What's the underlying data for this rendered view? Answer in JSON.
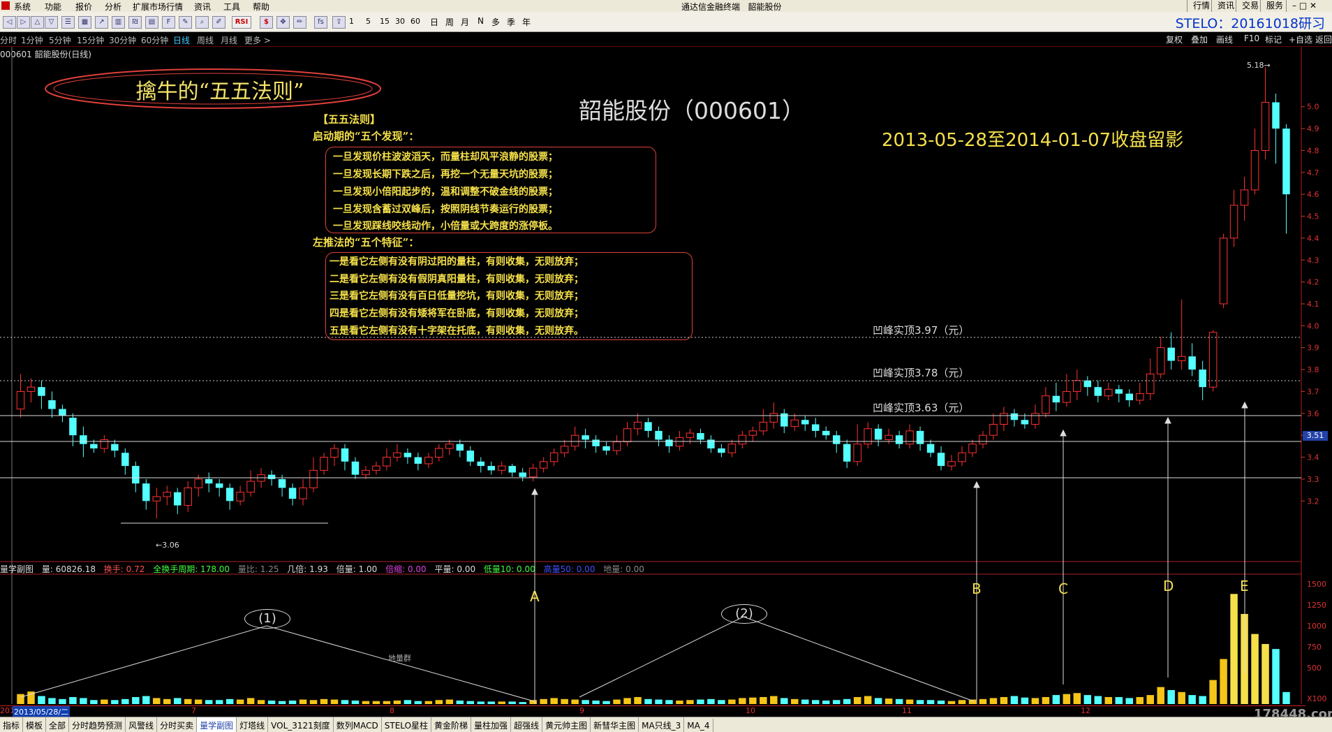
{
  "menubar": {
    "items": [
      "系统",
      "功能",
      "报价",
      "分析",
      "扩展市场行情",
      "资讯",
      "工具",
      "帮助"
    ],
    "window_title": "通达信金融终端",
    "stock_name": "韶能股份",
    "right_items": [
      "行情",
      "资讯",
      "交易",
      "服务"
    ]
  },
  "toolbar": {
    "icons": [
      "back-icon",
      "forward-icon",
      "up-icon",
      "down-icon",
      "list-icon",
      "grid-icon",
      "chart-icon",
      "bar-chart-icon",
      "quote-icon",
      "table-icon",
      "f10-icon",
      "notes-icon",
      "zoom-icon",
      "draw-icon",
      "rsi-icon",
      "money-icon",
      "crosshair-icon",
      "pen-icon",
      "fs-icon",
      "export-icon"
    ],
    "rsi_label": "RSI",
    "numbers": [
      "1",
      "5",
      "15",
      "30",
      "60"
    ],
    "periods": [
      "日",
      "周",
      "月",
      "N",
      "多",
      "季",
      "年"
    ],
    "logo": "STELO：20161018研习"
  },
  "period_bar": {
    "items": [
      "分时",
      "1分钟",
      "5分钟",
      "15分钟",
      "30分钟",
      "60分钟",
      "日线",
      "周线",
      "月线",
      "更多 >"
    ],
    "active": "日线",
    "right_items": [
      "复权",
      "叠加",
      "画线",
      "F10",
      "标记",
      "+自选",
      "返回"
    ]
  },
  "chart_title": "000601 韶能股份(日线)",
  "annotations": {
    "cloud_text": "擒牛的“五五法则”",
    "stock_title": "韶能股份（000601）",
    "date_note": "2013-05-28至2014-01-07收盘留影",
    "rules_title": "【五五法则】",
    "start_heading": "启动期的“五个发现”：",
    "discoveries": [
      "一旦发现价柱波波滔天，而量柱却风平浪静的股票；",
      "一旦发现长期下跌之后，再挖一个无量天坑的股票；",
      "一旦发现小倍阳起步的，温和调整不破金线的股票；",
      "一旦发现含蓄过双峰后，按照阴线节奏运行的股票；",
      "一旦发现踩线咬线动作，小倍量或大跨度的涨停板。"
    ],
    "left_heading": "左推法的“五个特征”：",
    "features": [
      "一是看它左侧有没有阴过阳的量柱，有则收集，无则放弃；",
      "二是看它左侧有没有假阴真阳量柱，有则收集，无则放弃；",
      "三是看它左侧有没有百日低量挖坑，有则收集，无则放弃；",
      "四是看它左侧有没有矮将军在卧底，有则收集，无则放弃；",
      "五是看它左侧有没有十字架在托底，有则收集，无则放弃。"
    ],
    "peaks": [
      "凹峰实顶3.97（元）",
      "凹峰实顶3.78（元）",
      "凹峰实顶3.63（元）"
    ],
    "low_label": "←3.06",
    "high_label": "5.18→",
    "markers": [
      "A",
      "B",
      "C",
      "D",
      "E"
    ],
    "circles": [
      "(1)",
      "(2)"
    ],
    "vol_note": "地量群"
  },
  "price_axis": [
    "5.0",
    "4.9",
    "4.8",
    "4.7",
    "4.6",
    "4.5",
    "4.4",
    "4.3",
    "4.2",
    "4.1",
    "4.0",
    "3.9",
    "3.8",
    "3.7",
    "3.6",
    "3.5",
    "3.4",
    "3.3",
    "3.2"
  ],
  "current_price": "3.51",
  "sub_indicator": {
    "name": "量学副图",
    "vol_label": "量: 60826.18",
    "turnover": "换手: 0.72",
    "total_turnover": "全换手周期: 178.00",
    "vol_ratio": "量比: 1.25",
    "multiple": "几倍: 1.93",
    "double": "倍量: 1.00",
    "shrink": "倍缩: 0.00",
    "flat": "平量: 0.00",
    "low10": "低量10: 0.00",
    "high50": "高量50: 0.00",
    "ground": "地量: 0.00"
  },
  "volume_axis": [
    "1500",
    "1250",
    "1000",
    "750",
    "500",
    "X100"
  ],
  "date_bar": {
    "selected": "2013/05/28/二",
    "months": [
      "7",
      "8",
      "9",
      "10",
      "11",
      "12"
    ],
    "left": "201"
  },
  "bottom_tabs": [
    "指标",
    "模板",
    "全部",
    "分时趋势预测",
    "风警线",
    "分时买卖",
    "量学副图",
    "灯塔线",
    "VOL_3121刻度",
    "数列MACD",
    "STELO星柱",
    "黄金阶梯",
    "量柱加强",
    "超强线",
    "黄元帅主图",
    "新彗华主图",
    "MA只线_3",
    "MA_4"
  ],
  "active_tab": "量学副图",
  "watermark": "178448.com",
  "colors": {
    "up": "#ff3232",
    "down": "#54ffff",
    "accent": "#f5e04a"
  },
  "chart_data": {
    "type": "candlestick",
    "title": "000601 韶能股份(日线)",
    "ylim": [
      3.0,
      5.2
    ],
    "candles": [
      [
        3.62,
        3.7,
        3.78,
        3.58
      ],
      [
        3.7,
        3.72,
        3.76,
        3.65
      ],
      [
        3.72,
        3.68,
        3.75,
        3.62
      ],
      [
        3.66,
        3.62,
        3.7,
        3.58
      ],
      [
        3.62,
        3.59,
        3.64,
        3.56
      ],
      [
        3.58,
        3.5,
        3.6,
        3.45
      ],
      [
        3.5,
        3.46,
        3.54,
        3.4
      ],
      [
        3.46,
        3.44,
        3.48,
        3.42
      ],
      [
        3.44,
        3.48,
        3.5,
        3.42
      ],
      [
        3.46,
        3.43,
        3.48,
        3.4
      ],
      [
        3.42,
        3.36,
        3.44,
        3.32
      ],
      [
        3.36,
        3.28,
        3.38,
        3.24
      ],
      [
        3.28,
        3.2,
        3.3,
        3.16
      ],
      [
        3.2,
        3.22,
        3.26,
        3.12
      ],
      [
        3.22,
        3.24,
        3.27,
        3.18
      ],
      [
        3.24,
        3.18,
        3.26,
        3.14
      ],
      [
        3.18,
        3.26,
        3.29,
        3.15
      ],
      [
        3.26,
        3.3,
        3.32,
        3.22
      ],
      [
        3.3,
        3.28,
        3.33,
        3.24
      ],
      [
        3.28,
        3.26,
        3.3,
        3.22
      ],
      [
        3.26,
        3.2,
        3.28,
        3.16
      ],
      [
        3.2,
        3.24,
        3.27,
        3.18
      ],
      [
        3.24,
        3.29,
        3.34,
        3.22
      ],
      [
        3.29,
        3.32,
        3.35,
        3.26
      ],
      [
        3.32,
        3.3,
        3.34,
        3.27
      ],
      [
        3.3,
        3.26,
        3.32,
        3.22
      ],
      [
        3.26,
        3.21,
        3.28,
        3.18
      ],
      [
        3.21,
        3.26,
        3.3,
        3.18
      ],
      [
        3.26,
        3.34,
        3.4,
        3.24
      ],
      [
        3.34,
        3.4,
        3.42,
        3.32
      ],
      [
        3.4,
        3.44,
        3.46,
        3.36
      ],
      [
        3.44,
        3.38,
        3.46,
        3.34
      ],
      [
        3.38,
        3.32,
        3.4,
        3.3
      ],
      [
        3.32,
        3.34,
        3.36,
        3.3
      ],
      [
        3.34,
        3.36,
        3.38,
        3.32
      ],
      [
        3.36,
        3.4,
        3.44,
        3.34
      ],
      [
        3.4,
        3.42,
        3.46,
        3.38
      ],
      [
        3.42,
        3.4,
        3.44,
        3.37
      ],
      [
        3.4,
        3.37,
        3.42,
        3.34
      ],
      [
        3.37,
        3.4,
        3.42,
        3.35
      ],
      [
        3.4,
        3.44,
        3.46,
        3.38
      ],
      [
        3.44,
        3.46,
        3.48,
        3.41
      ],
      [
        3.46,
        3.43,
        3.48,
        3.4
      ],
      [
        3.43,
        3.38,
        3.45,
        3.36
      ],
      [
        3.38,
        3.36,
        3.4,
        3.33
      ],
      [
        3.36,
        3.34,
        3.38,
        3.32
      ],
      [
        3.34,
        3.36,
        3.38,
        3.32
      ],
      [
        3.36,
        3.33,
        3.37,
        3.31
      ],
      [
        3.33,
        3.31,
        3.35,
        3.29
      ],
      [
        3.31,
        3.35,
        3.37,
        3.29
      ],
      [
        3.35,
        3.38,
        3.4,
        3.33
      ],
      [
        3.38,
        3.42,
        3.44,
        3.36
      ],
      [
        3.42,
        3.45,
        3.48,
        3.4
      ],
      [
        3.45,
        3.5,
        3.54,
        3.43
      ],
      [
        3.5,
        3.48,
        3.53,
        3.44
      ],
      [
        3.48,
        3.45,
        3.5,
        3.42
      ],
      [
        3.45,
        3.43,
        3.47,
        3.41
      ],
      [
        3.43,
        3.47,
        3.5,
        3.41
      ],
      [
        3.47,
        3.53,
        3.56,
        3.45
      ],
      [
        3.53,
        3.56,
        3.6,
        3.5
      ],
      [
        3.56,
        3.52,
        3.58,
        3.49
      ],
      [
        3.52,
        3.48,
        3.54,
        3.45
      ],
      [
        3.48,
        3.45,
        3.5,
        3.42
      ],
      [
        3.45,
        3.49,
        3.52,
        3.43
      ],
      [
        3.49,
        3.51,
        3.53,
        3.46
      ],
      [
        3.51,
        3.48,
        3.53,
        3.46
      ],
      [
        3.48,
        3.44,
        3.5,
        3.42
      ],
      [
        3.44,
        3.42,
        3.46,
        3.4
      ],
      [
        3.42,
        3.46,
        3.48,
        3.4
      ],
      [
        3.46,
        3.5,
        3.52,
        3.44
      ],
      [
        3.5,
        3.52,
        3.54,
        3.47
      ],
      [
        3.52,
        3.56,
        3.62,
        3.5
      ],
      [
        3.56,
        3.6,
        3.65,
        3.53
      ],
      [
        3.6,
        3.54,
        3.62,
        3.51
      ],
      [
        3.54,
        3.57,
        3.6,
        3.52
      ],
      [
        3.57,
        3.55,
        3.59,
        3.52
      ],
      [
        3.55,
        3.52,
        3.58,
        3.49
      ],
      [
        3.52,
        3.5,
        3.54,
        3.48
      ],
      [
        3.5,
        3.46,
        3.52,
        3.42
      ],
      [
        3.46,
        3.38,
        3.48,
        3.35
      ],
      [
        3.38,
        3.46,
        3.55,
        3.36
      ],
      [
        3.46,
        3.53,
        3.56,
        3.44
      ],
      [
        3.53,
        3.48,
        3.55,
        3.45
      ],
      [
        3.48,
        3.5,
        3.53,
        3.46
      ],
      [
        3.5,
        3.46,
        3.52,
        3.44
      ],
      [
        3.46,
        3.52,
        3.55,
        3.44
      ],
      [
        3.52,
        3.46,
        3.54,
        3.43
      ],
      [
        3.46,
        3.42,
        3.48,
        3.4
      ],
      [
        3.42,
        3.36,
        3.45,
        3.34
      ],
      [
        3.36,
        3.38,
        3.41,
        3.34
      ],
      [
        3.38,
        3.42,
        3.45,
        3.36
      ],
      [
        3.42,
        3.46,
        3.48,
        3.4
      ],
      [
        3.46,
        3.5,
        3.52,
        3.44
      ],
      [
        3.5,
        3.55,
        3.6,
        3.48
      ],
      [
        3.55,
        3.6,
        3.63,
        3.52
      ],
      [
        3.6,
        3.57,
        3.62,
        3.54
      ],
      [
        3.57,
        3.55,
        3.6,
        3.53
      ],
      [
        3.55,
        3.6,
        3.64,
        3.53
      ],
      [
        3.6,
        3.68,
        3.72,
        3.58
      ],
      [
        3.68,
        3.65,
        3.74,
        3.61
      ],
      [
        3.65,
        3.7,
        3.78,
        3.63
      ],
      [
        3.7,
        3.75,
        3.8,
        3.66
      ],
      [
        3.75,
        3.72,
        3.77,
        3.68
      ],
      [
        3.72,
        3.68,
        3.75,
        3.65
      ],
      [
        3.68,
        3.71,
        3.74,
        3.66
      ],
      [
        3.71,
        3.69,
        3.73,
        3.65
      ],
      [
        3.69,
        3.66,
        3.71,
        3.63
      ],
      [
        3.66,
        3.69,
        3.74,
        3.64
      ],
      [
        3.69,
        3.78,
        3.85,
        3.66
      ],
      [
        3.78,
        3.9,
        3.95,
        3.76
      ],
      [
        3.9,
        3.84,
        3.97,
        3.8
      ],
      [
        3.84,
        3.86,
        4.12,
        3.8
      ],
      [
        3.86,
        3.8,
        3.92,
        3.77
      ],
      [
        3.8,
        3.72,
        3.84,
        3.66
      ],
      [
        3.72,
        3.97,
        3.98,
        3.7
      ],
      [
        4.1,
        4.4,
        4.42,
        4.08
      ],
      [
        4.4,
        4.55,
        4.62,
        4.36
      ],
      [
        4.55,
        4.62,
        4.68,
        4.48
      ],
      [
        4.62,
        4.8,
        4.9,
        4.6
      ],
      [
        4.8,
        5.02,
        5.18,
        4.76
      ],
      [
        5.02,
        4.9,
        5.06,
        4.74
      ],
      [
        4.9,
        4.6,
        4.92,
        4.42
      ]
    ],
    "volumes": [
      20,
      25,
      16,
      12,
      10,
      14,
      12,
      8,
      9,
      8,
      10,
      14,
      16,
      12,
      10,
      12,
      10,
      9,
      8,
      8,
      10,
      9,
      12,
      8,
      7,
      6,
      7,
      9,
      8,
      10,
      9,
      8,
      7,
      6,
      6,
      6,
      7,
      8,
      6,
      6,
      8,
      9,
      7,
      6,
      5,
      5,
      5,
      5,
      4,
      8,
      10,
      12,
      10,
      9,
      8,
      7,
      6,
      9,
      12,
      14,
      10,
      9,
      8,
      7,
      8,
      9,
      10,
      8,
      9,
      12,
      13,
      14,
      16,
      12,
      10,
      9,
      8,
      7,
      8,
      10,
      14,
      16,
      12,
      11,
      10,
      9,
      8,
      8,
      7,
      6,
      8,
      9,
      10,
      12,
      14,
      16,
      13,
      12,
      14,
      18,
      20,
      22,
      18,
      16,
      14,
      14,
      12,
      14,
      18,
      34,
      28,
      24,
      18,
      16,
      48,
      90,
      220,
      180,
      140,
      120,
      110,
      24
    ],
    "xlabel": "",
    "ylabel": ""
  }
}
